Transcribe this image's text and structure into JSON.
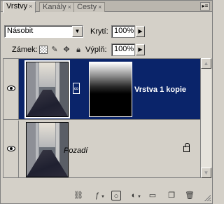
{
  "tabs": [
    {
      "label": "Vrstvy",
      "active": true
    },
    {
      "label": "Kanály",
      "active": false
    },
    {
      "label": "Cesty",
      "active": false
    }
  ],
  "blend_mode": "Násobit",
  "opacity": {
    "label": "Krytí:",
    "value": "100%"
  },
  "lock": {
    "label": "Zámek:"
  },
  "fill": {
    "label": "Výplň:",
    "value": "100%"
  },
  "layers": [
    {
      "name": "Vrstva 1 kopie",
      "selected": true,
      "visible": true,
      "has_mask": true
    },
    {
      "name": "Pozadí",
      "selected": false,
      "visible": true,
      "locked": true
    }
  ],
  "colors": {
    "selection": "#0a246a",
    "panel": "#d4d0c8"
  },
  "toolbar_icons": [
    "link-icon",
    "layer-style-icon",
    "add-mask-icon",
    "adjustment-layer-icon",
    "new-group-icon",
    "new-layer-icon",
    "trash-icon"
  ]
}
